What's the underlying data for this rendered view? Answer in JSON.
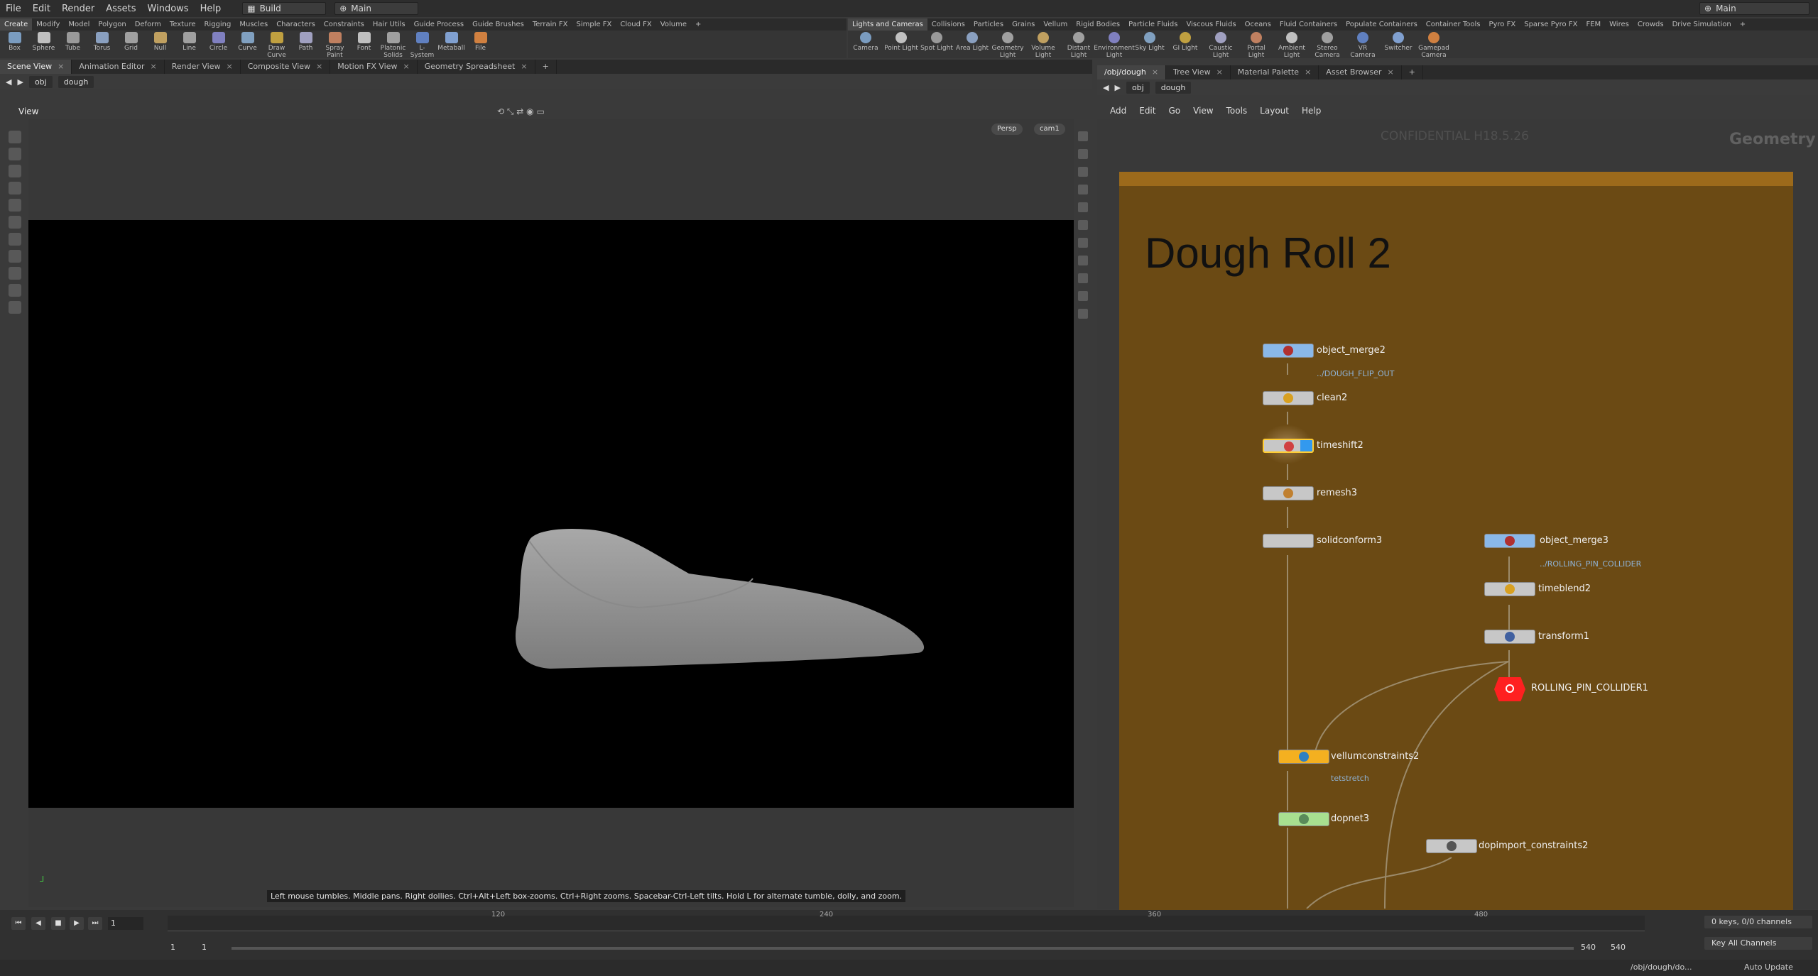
{
  "menubar": {
    "items": [
      "File",
      "Edit",
      "Render",
      "Assets",
      "Windows",
      "Help"
    ],
    "desktop": "Build",
    "layout": "Main",
    "right_layout": "Main"
  },
  "shelf_left": {
    "tabs": [
      "Create",
      "Modify",
      "Model",
      "Polygon",
      "Deform",
      "Texture",
      "Rigging",
      "Muscles",
      "Characters",
      "Constraints",
      "Hair Utils",
      "Guide Process",
      "Guide Brushes",
      "Terrain FX",
      "Simple FX",
      "Cloud FX",
      "Volume"
    ],
    "tools": [
      "Box",
      "Sphere",
      "Tube",
      "Torus",
      "Grid",
      "Null",
      "Line",
      "Circle",
      "Curve",
      "Draw Curve",
      "Path",
      "Spray Paint",
      "Font",
      "Platonic Solids",
      "L-System",
      "Metaball",
      "File"
    ]
  },
  "shelf_right": {
    "tabs": [
      "Lights and Cameras",
      "Collisions",
      "Particles",
      "Grains",
      "Vellum",
      "Rigid Bodies",
      "Particle Fluids",
      "Viscous Fluids",
      "Oceans",
      "Fluid Containers",
      "Populate Containers",
      "Container Tools",
      "Pyro FX",
      "Sparse Pyro FX",
      "FEM",
      "Wires",
      "Crowds",
      "Drive Simulation"
    ],
    "tools": [
      "Camera",
      "Point Light",
      "Spot Light",
      "Area Light",
      "Geometry Light",
      "Volume Light",
      "Distant Light",
      "Environment Light",
      "Sky Light",
      "GI Light",
      "Caustic Light",
      "Portal Light",
      "Ambient Light",
      "Stereo Camera",
      "VR Camera",
      "Switcher",
      "Gamepad Camera"
    ]
  },
  "left_pane": {
    "tabs": [
      "Scene View",
      "Animation Editor",
      "Render View",
      "Composite View",
      "Motion FX View",
      "Geometry Spreadsheet"
    ],
    "path": [
      "obj",
      "dough"
    ],
    "view_label": "View",
    "persp": "Persp",
    "camera": "cam1",
    "tip": "Left mouse tumbles. Middle pans. Right dollies. Ctrl+Alt+Left box-zooms. Ctrl+Right zooms. Spacebar-Ctrl-Left tilts. Hold L for alternate tumble, dolly, and zoom."
  },
  "right_pane": {
    "tabs": [
      "/obj/dough",
      "Tree View",
      "Material Palette",
      "Asset Browser"
    ],
    "path": [
      "obj",
      "dough"
    ],
    "menu": [
      "Add",
      "Edit",
      "Go",
      "View",
      "Tools",
      "Layout",
      "Help"
    ],
    "watermark": "CONFIDENTIAL H18.5.26",
    "context": "Geometry",
    "netbox_title": "Dough Roll 2",
    "nodes": {
      "object_merge2": "object_merge2",
      "object_merge2_sub": "../DOUGH_FLIP_OUT",
      "clean2": "clean2",
      "timeshift2": "timeshift2",
      "remesh3": "remesh3",
      "solidconform3": "solidconform3",
      "object_merge3": "object_merge3",
      "object_merge3_sub": "../ROLLING_PIN_COLLIDER",
      "timeblend2": "timeblend2",
      "transform1": "transform1",
      "rolling_null": "ROLLING_PIN_COLLIDER1",
      "vellumconstraints2": "vellumconstraints2",
      "vellum_sub": "tetstretch",
      "dopnet3": "dopnet3",
      "dopimport": "dopimport_constraints2"
    }
  },
  "timeline": {
    "frame": "1",
    "ticks": [
      "120",
      "240",
      "360",
      "480"
    ],
    "start": "1",
    "start2": "1",
    "end": "540",
    "end2": "540",
    "keys": "0 keys, 0/0 channels",
    "key_all": "Key All Channels",
    "auto_update": "Auto Update",
    "status_path": "/obj/dough/do..."
  }
}
